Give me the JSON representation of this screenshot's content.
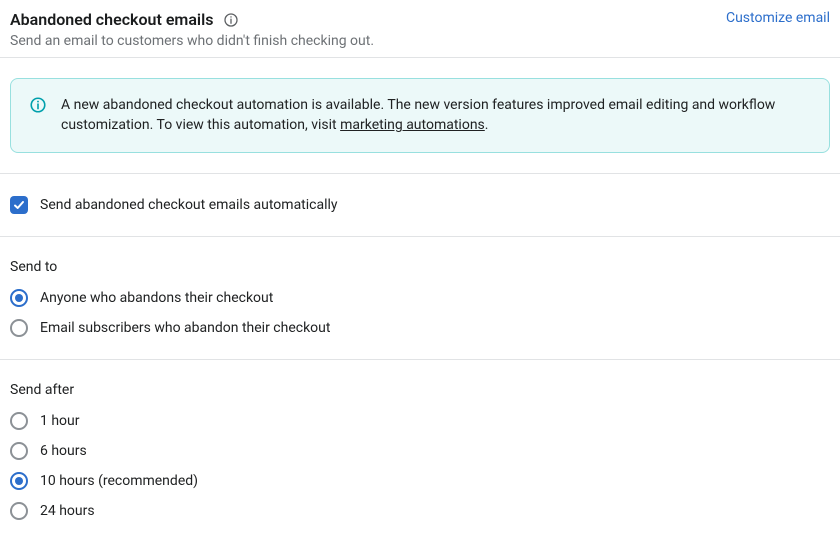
{
  "header": {
    "title": "Abandoned checkout emails",
    "subtitle": "Send an email to customers who didn't finish checking out.",
    "customize": "Customize email"
  },
  "banner": {
    "text_before": "A new abandoned checkout automation is available. The new version features improved email editing and workflow customization. To view this automation, visit ",
    "link_text": "marketing automations",
    "text_after": "."
  },
  "checkbox": {
    "label": "Send abandoned checkout emails automatically",
    "checked": true
  },
  "send_to": {
    "title": "Send to",
    "options": [
      {
        "label": "Anyone who abandons their checkout",
        "selected": true
      },
      {
        "label": "Email subscribers who abandon their checkout",
        "selected": false
      }
    ]
  },
  "send_after": {
    "title": "Send after",
    "options": [
      {
        "label": "1 hour",
        "selected": false
      },
      {
        "label": "6 hours",
        "selected": false
      },
      {
        "label": "10 hours (recommended)",
        "selected": true
      },
      {
        "label": "24 hours",
        "selected": false
      }
    ]
  }
}
